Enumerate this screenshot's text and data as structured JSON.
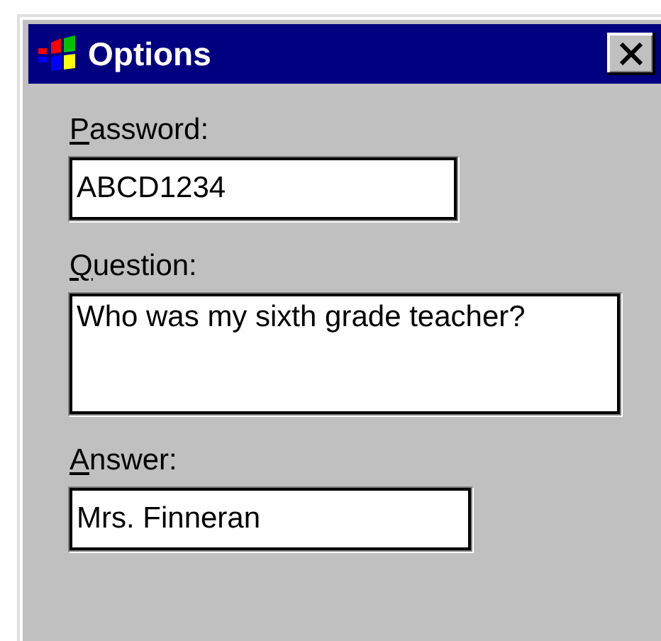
{
  "window": {
    "title": "Options"
  },
  "fields": [
    {
      "label": "Password:",
      "value": "ABCD1234",
      "kind": "line"
    },
    {
      "label": "Question:",
      "value": "Who was my sixth grade teacher?",
      "kind": "multiline"
    },
    {
      "label": "Answer:",
      "value": "Mrs. Finneran",
      "kind": "line"
    }
  ]
}
